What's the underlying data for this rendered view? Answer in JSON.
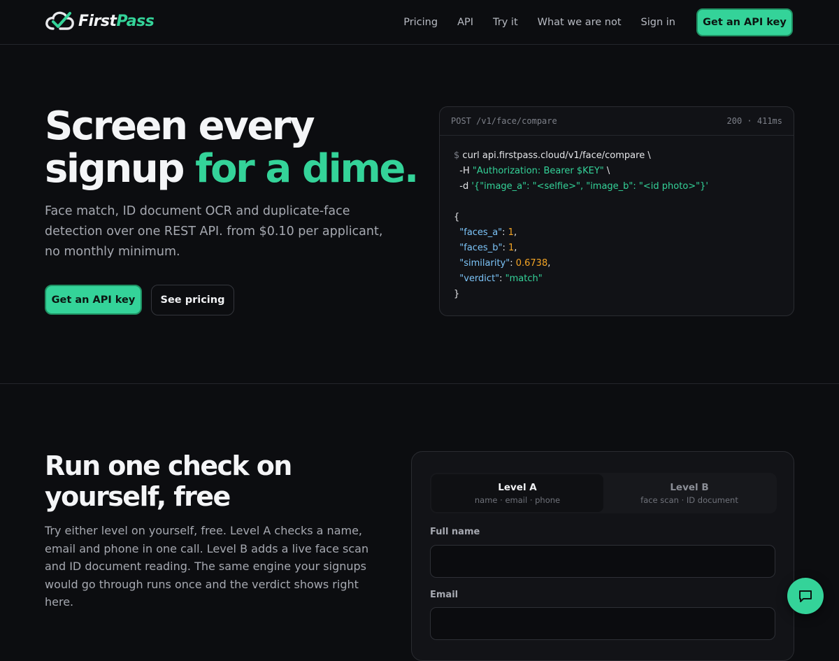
{
  "brand": {
    "name_first": "First",
    "name_second": "Pass",
    "accent": "#34d399",
    "background": "#0c0d10"
  },
  "nav": {
    "links": [
      "Pricing",
      "API",
      "Try it",
      "What we are not",
      "Sign in"
    ],
    "cta": "Get an API key"
  },
  "hero": {
    "title_line1": "Screen every",
    "title_line2_start": "signup ",
    "title_accent": "for a dime.",
    "subtitle": "Face match, ID document OCR and duplicate-face detection over one REST API. from $0.10 per applicant, no monthly minimum.",
    "primary_button": "Get an API key",
    "secondary_button": "See pricing"
  },
  "code_card": {
    "endpoint": "POST /v1/face/compare",
    "status": "200 · 411ms",
    "prompt": "$",
    "command": "curl api.firstpass.cloud/v1/face/compare \\",
    "header_flag": "-H",
    "header_value": "\"Authorization: Bearer $KEY\"",
    "data_flag": "-d",
    "data_value": "'{\"image_a\": \"<selfie>\", \"image_b\": \"<id photo>\"}'",
    "response": [
      {
        "key": "\"faces_a\"",
        "value": "1",
        "kind": "num"
      },
      {
        "key": "\"faces_b\"",
        "value": "1",
        "kind": "num"
      },
      {
        "key": "\"similarity\"",
        "value": "0.6738",
        "kind": "num"
      },
      {
        "key": "\"verdict\"",
        "value": "\"match\"",
        "kind": "str"
      }
    ]
  },
  "try_section": {
    "title": "Run one check on yourself, free",
    "subtitle": "Try either level on yourself, free. Level A checks a name, email and phone in one call. Level B adds a live face scan and ID document reading. The same engine your signups would go through runs once and the verdict shows right here.",
    "tabs": [
      {
        "label": "Level A",
        "sub": "name · email · phone",
        "active": true
      },
      {
        "label": "Level B",
        "sub": "face scan · ID document",
        "active": false
      }
    ],
    "fields": [
      {
        "label": "Full name",
        "value": ""
      },
      {
        "label": "Email",
        "value": ""
      }
    ]
  },
  "chat": {
    "icon": "chat-bubble-icon"
  }
}
